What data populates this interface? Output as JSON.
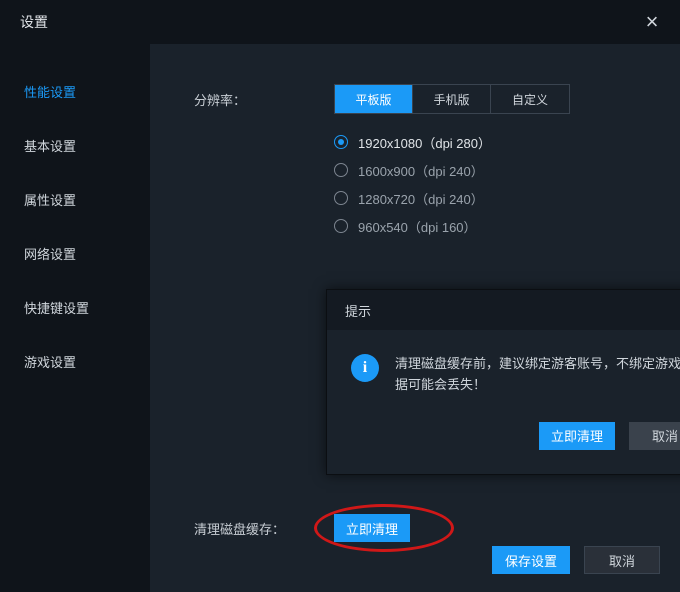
{
  "window": {
    "title": "设置"
  },
  "sidebar": {
    "items": [
      {
        "label": "性能设置",
        "active": true
      },
      {
        "label": "基本设置",
        "active": false
      },
      {
        "label": "属性设置",
        "active": false
      },
      {
        "label": "网络设置",
        "active": false
      },
      {
        "label": "快捷键设置",
        "active": false
      },
      {
        "label": "游戏设置",
        "active": false
      }
    ]
  },
  "main": {
    "resolution_label": "分辨率：",
    "tabs": [
      {
        "label": "平板版",
        "active": true
      },
      {
        "label": "手机版",
        "active": false
      },
      {
        "label": "自定义",
        "active": false
      }
    ],
    "resolutions": [
      {
        "label": "1920x1080（dpi 280）",
        "selected": true
      },
      {
        "label": "1600x900（dpi 240）",
        "selected": false
      },
      {
        "label": "1280x720（dpi 240）",
        "selected": false
      },
      {
        "label": "960x540（dpi 160）",
        "selected": false
      }
    ],
    "clear_cache_label": "清理磁盘缓存：",
    "clear_cache_button": "立即清理"
  },
  "dialog": {
    "title": "提示",
    "message": "清理磁盘缓存前，建议绑定游客账号，不绑定游戏数据可能会丢失！",
    "confirm": "立即清理",
    "cancel": "取消"
  },
  "footer": {
    "save": "保存设置",
    "cancel": "取消"
  }
}
